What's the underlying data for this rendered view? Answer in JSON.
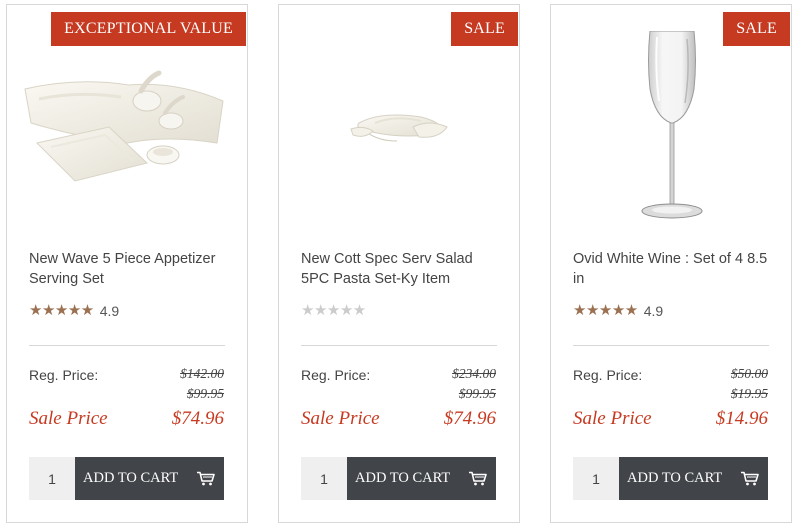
{
  "colors": {
    "accent": "#c63a22",
    "star": "#9b7152",
    "button": "#414449"
  },
  "products": [
    {
      "badge": "EXCEPTIONAL VALUE",
      "image": "appetizer-serving-set",
      "title": "New Wave 5 Piece Appetizer Serving Set",
      "stars": "★★★★★",
      "rated": true,
      "rating": "4.9",
      "reg_label": "Reg. Price:",
      "reg_price": "$142.00",
      "prev_price": "$99.95",
      "sale_label": "Sale Price",
      "sale_price": "$74.96",
      "qty": "1",
      "button_label": "ADD TO CART",
      "button_icon": "cart-icon"
    },
    {
      "badge": "SALE",
      "image": "salad-pasta-set",
      "title": "New Cott Spec Serv Salad 5PC Pasta Set-Ky Item",
      "stars": "★★★★★",
      "rated": false,
      "rating": "",
      "reg_label": "Reg. Price:",
      "reg_price": "$234.00",
      "prev_price": "$99.95",
      "sale_label": "Sale Price",
      "sale_price": "$74.96",
      "qty": "1",
      "button_label": "ADD TO CART",
      "button_icon": "cart-icon"
    },
    {
      "badge": "SALE",
      "image": "white-wine-glass",
      "title": "Ovid White Wine : Set of 4 8.5 in",
      "stars": "★★★★★",
      "rated": true,
      "rating": "4.9",
      "reg_label": "Reg. Price:",
      "reg_price": "$50.00",
      "prev_price": "$19.95",
      "sale_label": "Sale Price",
      "sale_price": "$14.96",
      "qty": "1",
      "button_label": "ADD TO CART",
      "button_icon": "cart-icon"
    }
  ]
}
